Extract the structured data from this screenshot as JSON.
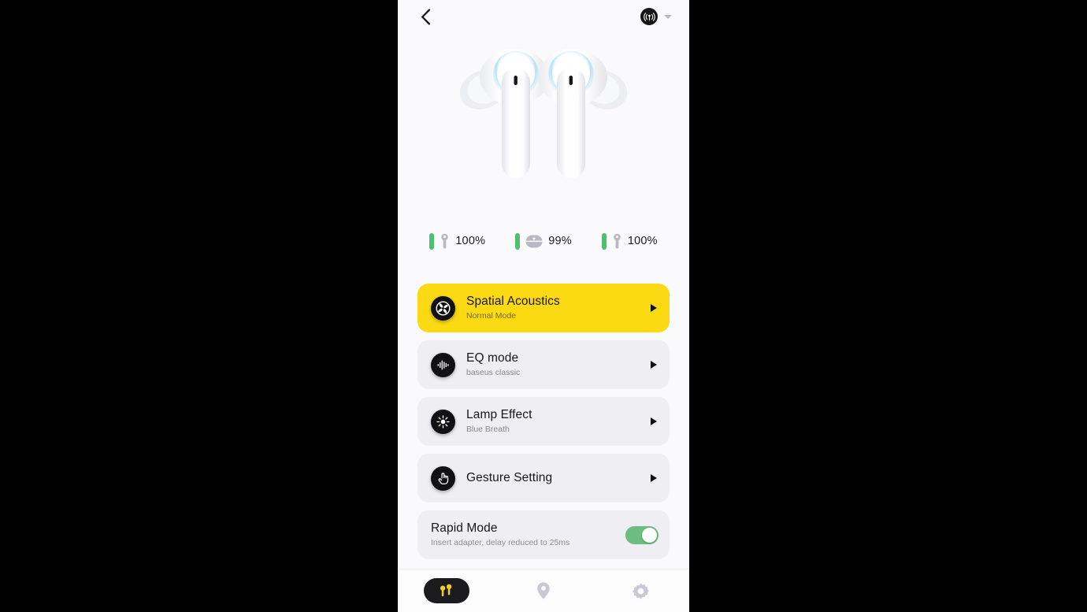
{
  "app": {
    "background_color": "#fafafc",
    "accent_color": "#fbd913",
    "toggle_on_color": "#6cbd7f",
    "battery_bar_color": "#4dbf72"
  },
  "topbar": {
    "back_icon": "chevron-left-icon",
    "device_icon": "broadcast-signal-icon",
    "dropdown_icon": "chevron-down-icon"
  },
  "hero": {
    "product_image": "white-wireless-earbuds",
    "accent_ring_color": "#aadff2"
  },
  "battery": {
    "items": [
      {
        "icon": "left-earbud-icon",
        "value": "100%"
      },
      {
        "icon": "charging-case-icon",
        "value": "99%"
      },
      {
        "icon": "right-earbud-icon",
        "value": "100%"
      }
    ]
  },
  "cards": [
    {
      "icon": "spatial-audio-icon",
      "title": "Spatial Acoustics",
      "subtitle": "Normal Mode",
      "highlighted": true,
      "arrow": "chevron-right-icon"
    },
    {
      "icon": "equalizer-waveform-icon",
      "title": "EQ mode",
      "subtitle": "baseus classic",
      "highlighted": false,
      "arrow": "chevron-right-icon"
    },
    {
      "icon": "lamp-brightness-icon",
      "title": "Lamp Effect",
      "subtitle": "Blue Breath",
      "highlighted": false,
      "arrow": "chevron-right-icon"
    },
    {
      "icon": "hand-tap-gesture-icon",
      "title": "Gesture Setting",
      "subtitle": "",
      "highlighted": false,
      "arrow": "chevron-right-icon"
    }
  ],
  "rapid_mode": {
    "title": "Rapid Mode",
    "subtitle": "Insert adapter, delay reduced to 25ms",
    "toggle_state": "on"
  },
  "bottom_nav": {
    "items": [
      {
        "icon": "earbuds-icon",
        "active": true
      },
      {
        "icon": "location-pin-icon",
        "active": false
      },
      {
        "icon": "gear-settings-icon",
        "active": false
      }
    ]
  }
}
